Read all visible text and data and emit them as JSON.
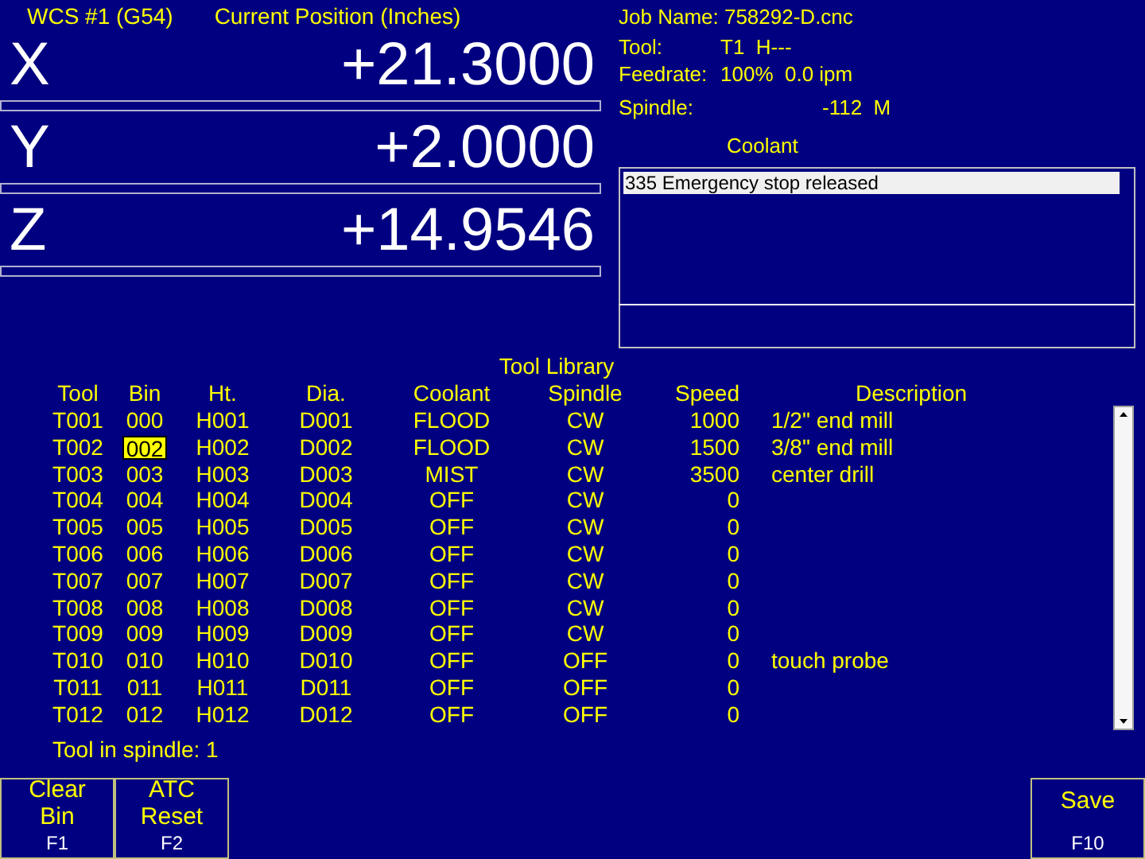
{
  "position": {
    "wcs": "WCS #1 (G54)",
    "title": "Current Position (Inches)",
    "axes": [
      {
        "axis": "X",
        "value": "+21.3000"
      },
      {
        "axis": "Y",
        "value": "+2.0000"
      },
      {
        "axis": "Z",
        "value": "+14.9546"
      }
    ]
  },
  "status": {
    "job_name": "Job Name: 758292-D.cnc",
    "tool_label": "Tool:",
    "tool_value": "T1  H---",
    "feedrate_label": "Feedrate:",
    "feedrate_value": "100%  0.0 ipm",
    "spindle_label": "Spindle:",
    "spindle_value": "-112  M",
    "coolant_label": "Coolant"
  },
  "messages": [
    {
      "text": "335 Emergency stop released",
      "selected": true
    }
  ],
  "tool_library": {
    "title": "Tool Library",
    "columns": [
      "Tool",
      "Bin",
      "Ht.",
      "Dia.",
      "Coolant",
      "Spindle",
      "Speed",
      "Description"
    ],
    "rows": [
      {
        "tool": "T001",
        "bin": "000",
        "ht": "H001",
        "dia": "D001",
        "coolant": "FLOOD",
        "spindle": "CW",
        "speed": "1000",
        "description": "1/2\" end mill",
        "selected": false
      },
      {
        "tool": "T002",
        "bin": "002",
        "ht": "H002",
        "dia": "D002",
        "coolant": "FLOOD",
        "spindle": "CW",
        "speed": "1500",
        "description": "3/8\" end mill",
        "selected": true
      },
      {
        "tool": "T003",
        "bin": "003",
        "ht": "H003",
        "dia": "D003",
        "coolant": "MIST",
        "spindle": "CW",
        "speed": "3500",
        "description": "center drill",
        "selected": false
      },
      {
        "tool": "T004",
        "bin": "004",
        "ht": "H004",
        "dia": "D004",
        "coolant": "OFF",
        "spindle": "CW",
        "speed": "0",
        "selected": false
      },
      {
        "tool": "T005",
        "bin": "005",
        "ht": "H005",
        "dia": "D005",
        "coolant": "OFF",
        "spindle": "CW",
        "speed": "0",
        "selected": false
      },
      {
        "tool": "T006",
        "bin": "006",
        "ht": "H006",
        "dia": "D006",
        "coolant": "OFF",
        "spindle": "CW",
        "speed": "0",
        "selected": false
      },
      {
        "tool": "T007",
        "bin": "007",
        "ht": "H007",
        "dia": "D007",
        "coolant": "OFF",
        "spindle": "CW",
        "speed": "0",
        "selected": false
      },
      {
        "tool": "T008",
        "bin": "008",
        "ht": "H008",
        "dia": "D008",
        "coolant": "OFF",
        "spindle": "CW",
        "speed": "0",
        "selected": false
      },
      {
        "tool": "T009",
        "bin": "009",
        "ht": "H009",
        "dia": "D009",
        "coolant": "OFF",
        "spindle": "CW",
        "speed": "0",
        "selected": false
      },
      {
        "tool": "T010",
        "bin": "010",
        "ht": "H010",
        "dia": "D010",
        "coolant": "OFF",
        "spindle": "OFF",
        "speed": "0",
        "description": "touch probe",
        "selected": false
      },
      {
        "tool": "T011",
        "bin": "011",
        "ht": "H011",
        "dia": "D011",
        "coolant": "OFF",
        "spindle": "OFF",
        "speed": "0",
        "selected": false
      },
      {
        "tool": "T012",
        "bin": "012",
        "ht": "H012",
        "dia": "D012",
        "coolant": "OFF",
        "spindle": "OFF",
        "speed": "0",
        "selected": false
      }
    ],
    "tool_in_spindle": "Tool in spindle: 1"
  },
  "function_keys_left": [
    {
      "label": [
        "Clear",
        "Bin"
      ],
      "key": "F1"
    },
    {
      "label": [
        "ATC",
        "Reset"
      ],
      "key": "F2"
    }
  ],
  "function_keys_right": [
    {
      "label": [
        "Save"
      ],
      "key": "F10"
    }
  ]
}
